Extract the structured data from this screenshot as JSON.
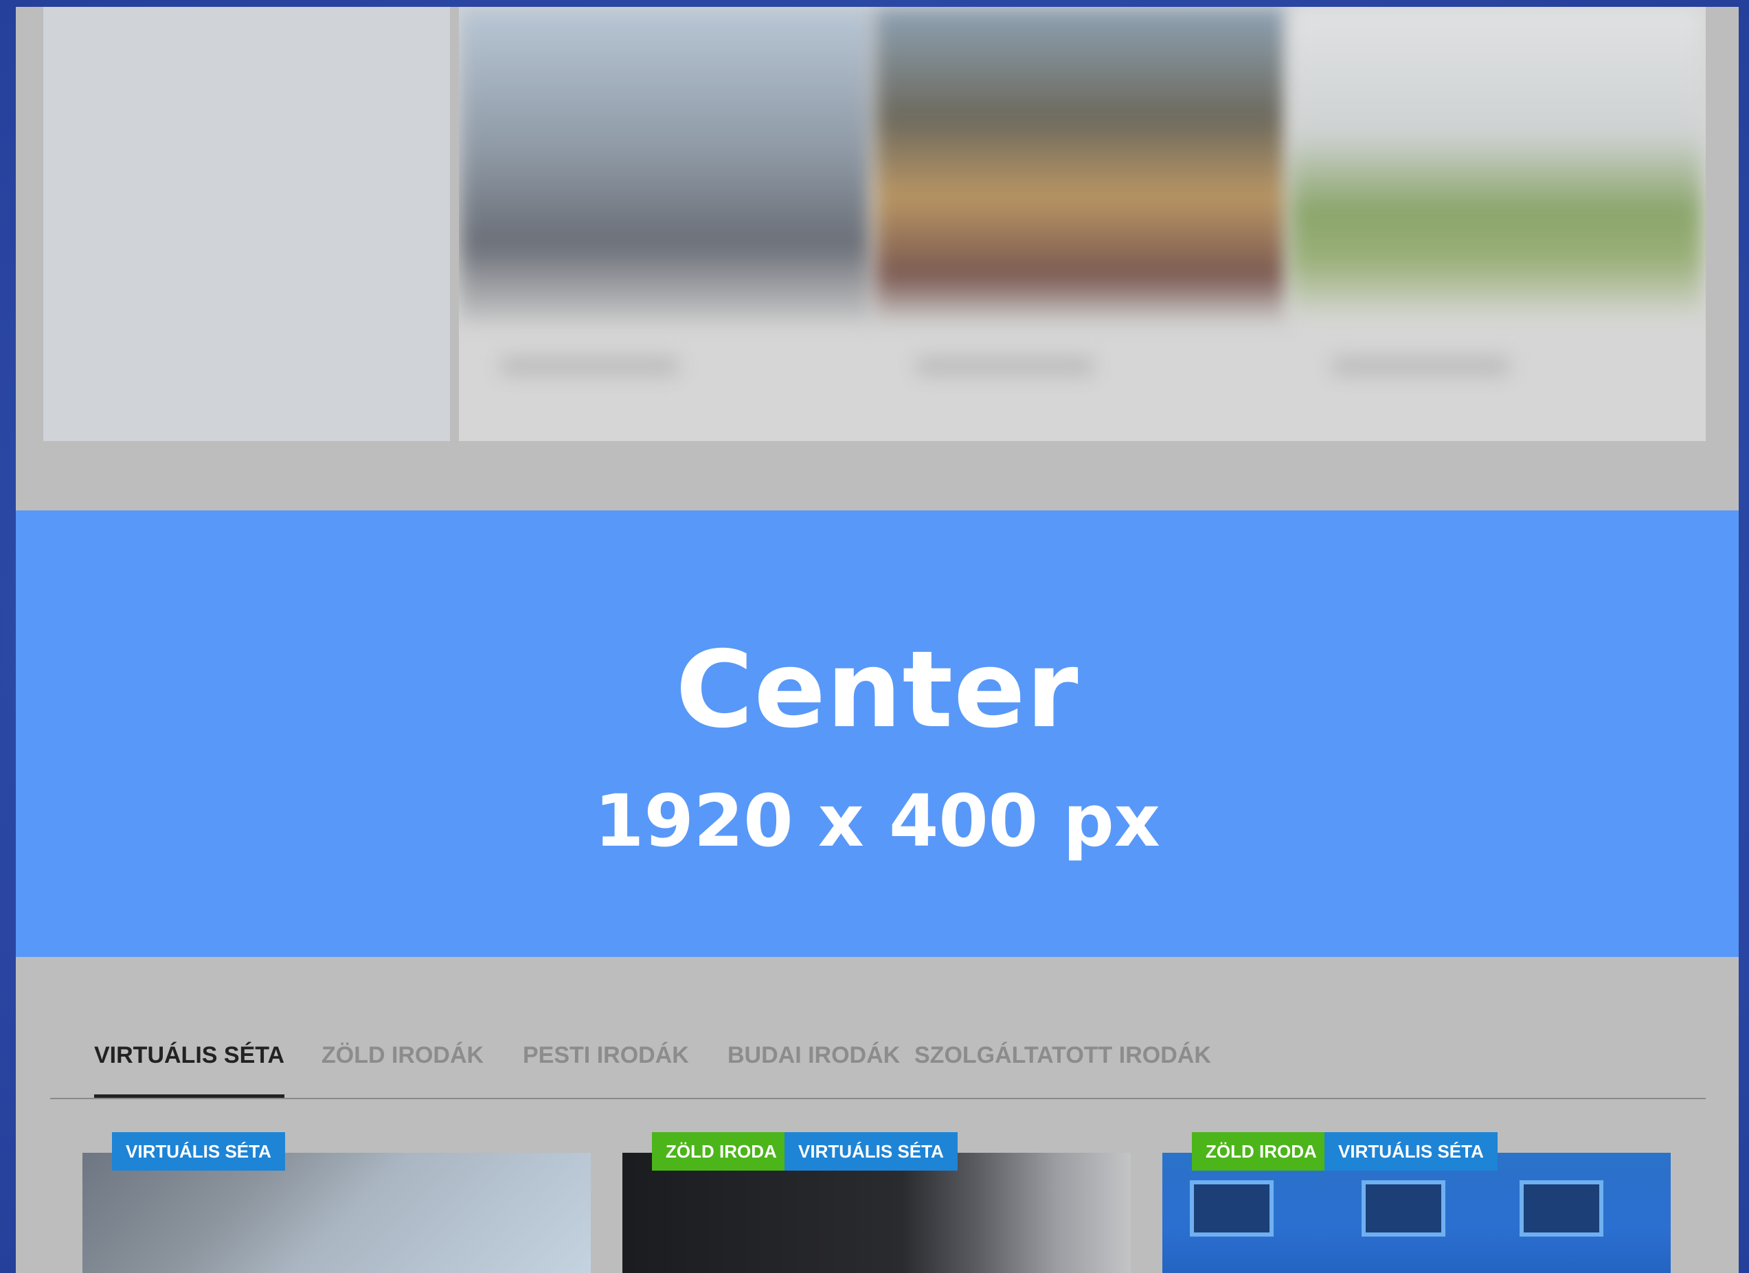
{
  "banner": {
    "title": "Center",
    "subtitle": "1920 x 400 px"
  },
  "tabs": [
    {
      "label": "VIRTUÁLIS SÉTA",
      "active": true
    },
    {
      "label": "ZÖLD IRODÁK",
      "active": false
    },
    {
      "label": "PESTI IRODÁK",
      "active": false
    },
    {
      "label": "BUDAI IRODÁK",
      "active": false
    },
    {
      "label": "SZOLGÁLTATOTT IRODÁK",
      "active": false
    }
  ],
  "listings": [
    {
      "badges": [
        {
          "label": "VIRTUÁLIS SÉTA",
          "color": "#1e84d6"
        }
      ]
    },
    {
      "badges": [
        {
          "label": "ZÖLD IRODA",
          "color": "#4cb51a"
        },
        {
          "label": "VIRTUÁLIS SÉTA",
          "color": "#1e84d6"
        }
      ]
    },
    {
      "badges": [
        {
          "label": "ZÖLD IRODA",
          "color": "#4cb51a"
        },
        {
          "label": "VIRTUÁLIS SÉTA",
          "color": "#1e84d6"
        }
      ]
    }
  ],
  "colors": {
    "banner": "#5898f8",
    "badge_blue": "#1e84d6",
    "badge_green": "#4cb51a",
    "overlay": "#bdbdbd"
  }
}
